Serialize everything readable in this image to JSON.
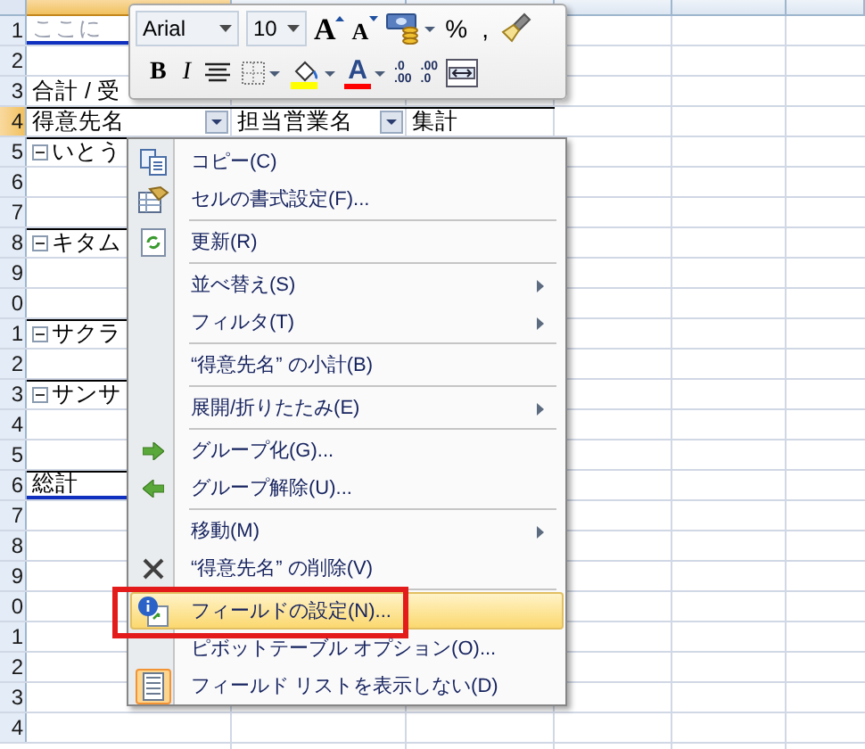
{
  "sheet": {
    "columns": [
      {
        "selected": true
      },
      {
        "selected": false
      },
      {
        "selected": false
      },
      {
        "selected": false
      },
      {
        "selected": false
      },
      {
        "selected": false
      }
    ],
    "rows": [
      {
        "number": "1",
        "selected": false,
        "cells": [
          {
            "text": "ここに",
            "dimmed": true,
            "expander": false,
            "dropdown": false
          }
        ]
      },
      {
        "number": "2",
        "selected": false
      },
      {
        "number": "3",
        "selected": false,
        "cells": [
          {
            "text": "合計 / 受",
            "dimmed": false,
            "expander": false,
            "dropdown": false
          }
        ]
      },
      {
        "number": "4",
        "selected": true,
        "cells": [
          {
            "text": "得意先名",
            "dimmed": false,
            "expander": false,
            "dropdown": true
          },
          {
            "text": "担当営業名",
            "dimmed": false,
            "expander": false,
            "dropdown": true
          },
          {
            "text": "集計",
            "dimmed": false,
            "expander": false,
            "dropdown": false
          }
        ]
      },
      {
        "number": "5",
        "selected": false,
        "cells": [
          {
            "text": "いとう",
            "dimmed": false,
            "expander": true,
            "dropdown": false
          }
        ]
      },
      {
        "number": "6",
        "selected": false
      },
      {
        "number": "7",
        "selected": false
      },
      {
        "number": "8",
        "selected": false,
        "cells": [
          {
            "text": "キタム",
            "dimmed": false,
            "expander": true,
            "dropdown": false
          }
        ]
      },
      {
        "number": "9",
        "selected": false
      },
      {
        "number": "0",
        "selected": false
      },
      {
        "number": "1",
        "selected": false,
        "cells": [
          {
            "text": "サクラ",
            "dimmed": false,
            "expander": true,
            "dropdown": false
          }
        ]
      },
      {
        "number": "2",
        "selected": false
      },
      {
        "number": "3",
        "selected": false,
        "cells": [
          {
            "text": "サンサ",
            "dimmed": false,
            "expander": true,
            "dropdown": false
          }
        ]
      },
      {
        "number": "4",
        "selected": false
      },
      {
        "number": "5",
        "selected": false
      },
      {
        "number": "6",
        "selected": false,
        "cells": [
          {
            "text": "総計",
            "dimmed": false,
            "expander": false,
            "dropdown": false
          }
        ]
      },
      {
        "number": "7",
        "selected": false
      },
      {
        "number": "8",
        "selected": false
      },
      {
        "number": "9",
        "selected": false
      },
      {
        "number": "0",
        "selected": false
      },
      {
        "number": "1",
        "selected": false
      },
      {
        "number": "2",
        "selected": false
      },
      {
        "number": "3",
        "selected": false
      },
      {
        "number": "4",
        "selected": false
      }
    ]
  },
  "mini_toolbar": {
    "font": "Arial",
    "size": "10",
    "row_1": [
      {
        "kind": "grow-font",
        "glyph": "A",
        "dropdown": false
      },
      {
        "kind": "shrink-font",
        "glyph": "A",
        "dropdown": false
      },
      {
        "kind": "accounting",
        "dropdown": true
      },
      {
        "kind": "percent",
        "glyph": "%",
        "dropdown": false
      },
      {
        "kind": "comma",
        "glyph": ",",
        "dropdown": false
      },
      {
        "kind": "format-painter",
        "dropdown": false
      }
    ],
    "row_2": [
      {
        "kind": "bold",
        "glyph": "B",
        "dropdown": false
      },
      {
        "kind": "italic",
        "glyph": "I",
        "dropdown": false
      },
      {
        "kind": "center",
        "dropdown": false
      },
      {
        "kind": "borders",
        "dropdown": true
      },
      {
        "kind": "fill-color",
        "color": "#ffff00",
        "dropdown": true
      },
      {
        "kind": "font-color",
        "glyph": "A",
        "color": "#ff0000",
        "dropdown": true
      },
      {
        "kind": "increase-decimal",
        "top": ".0",
        "bottom": ".00",
        "dropdown": false
      },
      {
        "kind": "decrease-decimal",
        "top": ".00",
        "bottom": ".0",
        "dropdown": false
      },
      {
        "kind": "merge-center",
        "dropdown": false
      }
    ]
  },
  "context_menu": {
    "groups": [
      [
        {
          "label": "コピー(C)",
          "submenu": false,
          "selected": false,
          "checked": false,
          "outlined": false
        },
        {
          "label": "セルの書式設定(F)...",
          "submenu": false,
          "selected": false,
          "checked": false,
          "outlined": false
        }
      ],
      [
        {
          "label": "更新(R)",
          "submenu": false,
          "selected": false,
          "checked": false,
          "outlined": false
        }
      ],
      [
        {
          "label": "並べ替え(S)",
          "submenu": true,
          "selected": false,
          "checked": false,
          "outlined": false
        },
        {
          "label": "フィルタ(T)",
          "submenu": true,
          "selected": false,
          "checked": false,
          "outlined": false
        }
      ],
      [
        {
          "label": "“得意先名” の小計(B)",
          "submenu": false,
          "selected": false,
          "checked": false,
          "outlined": false
        }
      ],
      [
        {
          "label": "展開/折りたたみ(E)",
          "submenu": true,
          "selected": false,
          "checked": false,
          "outlined": false
        }
      ],
      [
        {
          "label": "グループ化(G)...",
          "submenu": false,
          "selected": false,
          "checked": false,
          "outlined": false
        },
        {
          "label": "グループ解除(U)...",
          "submenu": false,
          "selected": false,
          "checked": false,
          "outlined": false
        }
      ],
      [
        {
          "label": "移動(M)",
          "submenu": true,
          "selected": false,
          "checked": false,
          "outlined": false
        },
        {
          "label": "“得意先名” の削除(V)",
          "submenu": false,
          "selected": false,
          "checked": false,
          "outlined": false
        }
      ],
      [
        {
          "label": "フィールドの設定(N)...",
          "submenu": false,
          "selected": true,
          "checked": false,
          "outlined": true
        },
        {
          "label": "ピボットテーブル オプション(O)...",
          "submenu": false,
          "selected": false,
          "checked": false,
          "outlined": false
        },
        {
          "label": "フィールド リストを表示しない(D)",
          "submenu": false,
          "selected": false,
          "checked": true,
          "outlined": false
        }
      ]
    ]
  }
}
